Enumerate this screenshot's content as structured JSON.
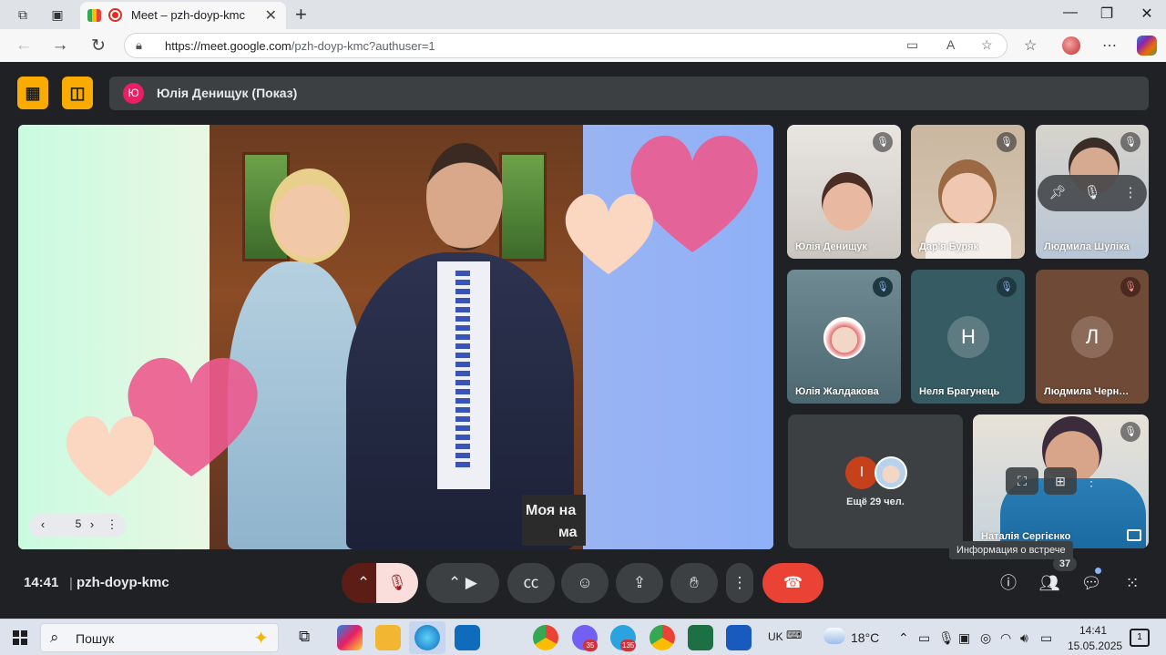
{
  "browser": {
    "tab_title": "Meet – pzh-doyp-kmc",
    "url_host": "https://meet.google.com",
    "url_path": "/pzh-doyp-kmc?authuser=1"
  },
  "meet": {
    "presenter_initial": "Ю",
    "presenter_label": "Юлія Денищук (Показ)",
    "caption_lines": [
      "Моя на",
      "ма"
    ],
    "slide_page": "5",
    "tiles": [
      {
        "name": "Юлія Денищук"
      },
      {
        "name": "Дар'я Буряк"
      },
      {
        "name": "Людмила Шуліка"
      },
      {
        "name": "Юлія Жалдакова"
      },
      {
        "name": "Неля Брагунець",
        "initial": "Н"
      },
      {
        "name": "Людмила Черн…",
        "initial": "Л"
      },
      {
        "more_initial": "І",
        "more_label": "Ещё 29 чел."
      },
      {
        "name": "Наталія Сергієнко"
      }
    ],
    "tooltip": "Информация о встрече",
    "participants_count": "37",
    "time": "14:41",
    "separator": "|",
    "meeting_code": "pzh-doyp-kmc"
  },
  "taskbar": {
    "search_placeholder": "Пошук",
    "badges": {
      "viber": "35",
      "telegram": "135"
    },
    "lang": "UK",
    "temperature": "18°C",
    "time": "14:41",
    "date": "15.05.2025",
    "notifications": "1"
  },
  "colors": {
    "meet_bg": "#202124",
    "accent_yellow": "#f9ab00",
    "end_call": "#ea4335",
    "mic_off_bg": "#f9dedc"
  }
}
